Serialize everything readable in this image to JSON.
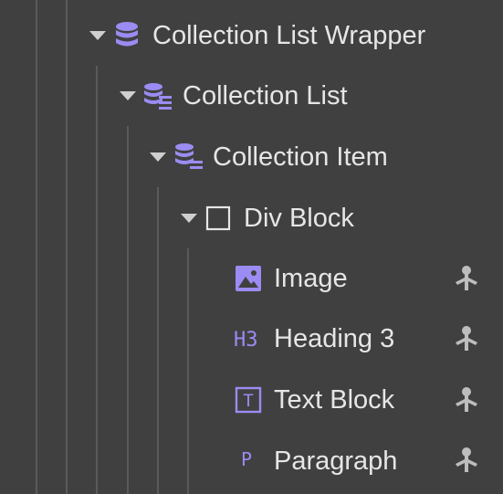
{
  "navigator": {
    "accent_color": "#9a8cf2",
    "items": [
      {
        "label": "Collection List Wrapper",
        "icon": "collection-wrapper-icon",
        "expanded": true,
        "has_settings": false
      },
      {
        "label": "Collection List",
        "icon": "collection-list-icon",
        "expanded": true,
        "has_settings": false
      },
      {
        "label": "Collection Item",
        "icon": "collection-item-icon",
        "expanded": true,
        "has_settings": false
      },
      {
        "label": "Div Block",
        "icon": "div-block-icon",
        "expanded": true,
        "has_settings": false
      },
      {
        "label": "Image",
        "icon": "image-icon",
        "has_settings": true
      },
      {
        "label": "Heading 3",
        "icon": "h3-icon",
        "icon_text": "H3",
        "has_settings": true
      },
      {
        "label": "Text Block",
        "icon": "text-block-icon",
        "icon_text": "T",
        "has_settings": true
      },
      {
        "label": "Paragraph",
        "icon": "paragraph-icon",
        "icon_text": "P",
        "has_settings": true
      }
    ],
    "settings_icon": "element-settings-icon"
  }
}
